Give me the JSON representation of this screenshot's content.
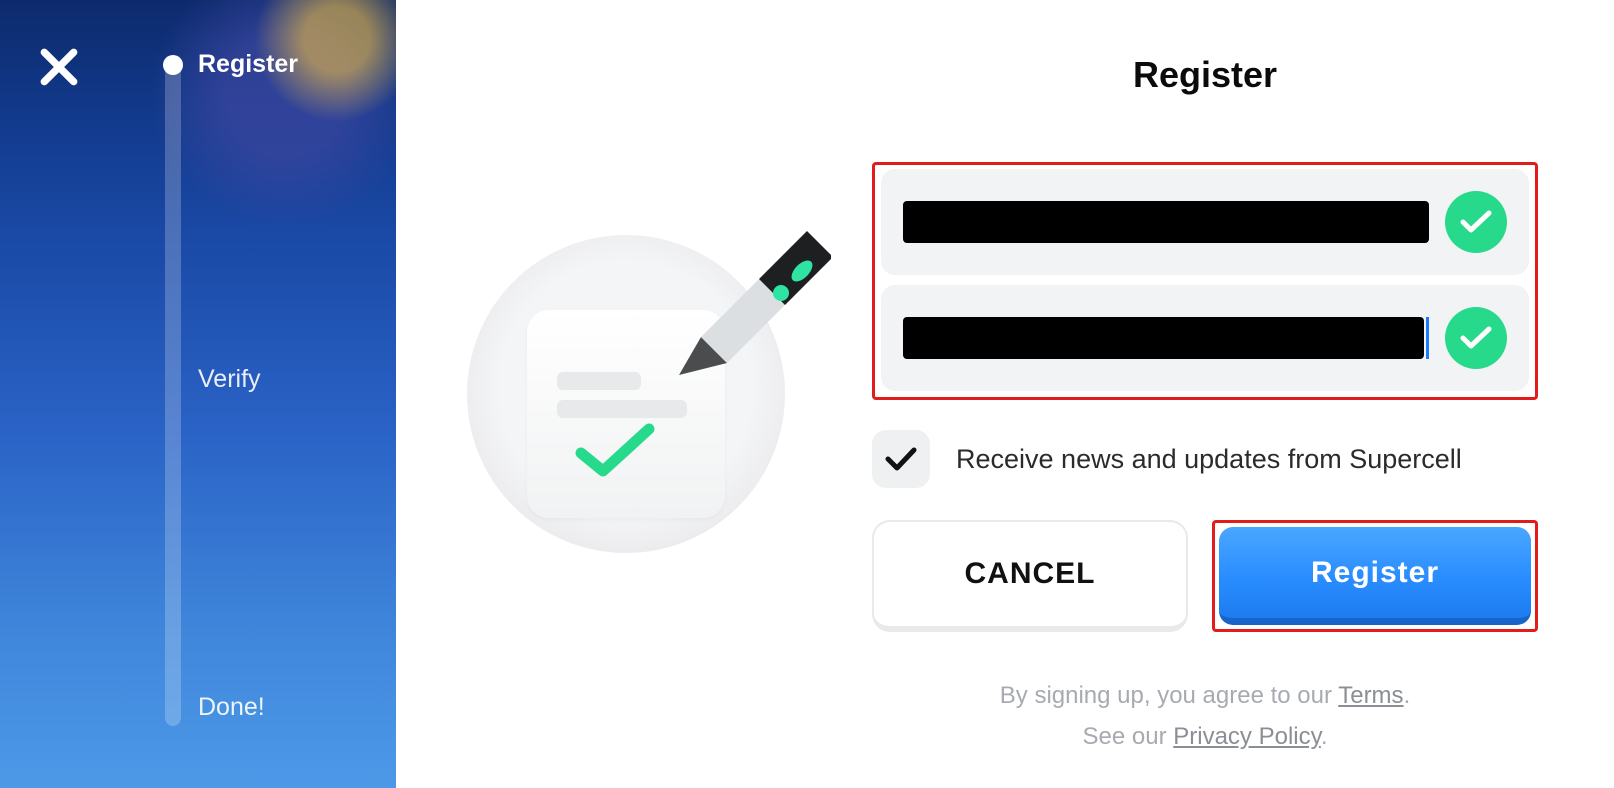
{
  "sidebar": {
    "steps": {
      "s1": "Register",
      "s2": "Verify",
      "s3": "Done!"
    }
  },
  "form": {
    "title": "Register",
    "optin_label": "Receive news and updates from Supercell",
    "buttons": {
      "cancel": "Cancel",
      "register": "Register"
    },
    "legal": {
      "line1_a": "By signing up, you agree to our ",
      "terms": "Terms",
      "period1": ".",
      "line2_a": "See our ",
      "privacy": "Privacy Policy",
      "period2": "."
    }
  }
}
